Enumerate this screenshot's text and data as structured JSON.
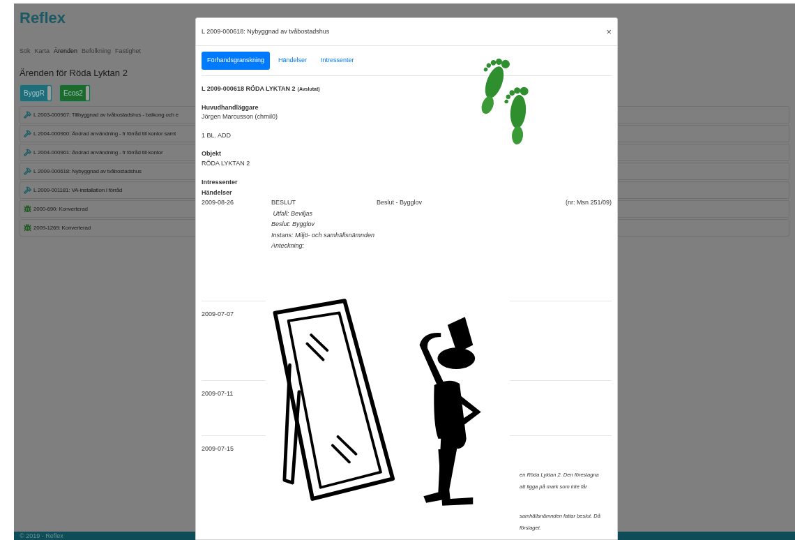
{
  "app": {
    "brand": "Reflex",
    "nav": [
      {
        "label": "Sök",
        "selected": false
      },
      {
        "label": "Karta",
        "selected": false
      },
      {
        "label": "Ärenden",
        "selected": true
      },
      {
        "label": "Befolkning",
        "selected": false
      },
      {
        "label": "Fastighet",
        "selected": false
      }
    ],
    "heading": "Ärenden för Röda Lyktan 2",
    "systems": [
      {
        "label": "ByggR",
        "color": "#1f6d7a",
        "on": true
      },
      {
        "label": "Ecos2",
        "color": "#1d6b2c",
        "on": true
      }
    ],
    "cases": [
      {
        "kind": "hammer",
        "label": "L 2003-000967: Tillbyggnad av tvåbostadshus - balkong och e"
      },
      {
        "kind": "hammer",
        "label": "L 2004-000960: Ändrad användning - fr förråd till kontor samt"
      },
      {
        "kind": "hammer",
        "label": "L 2004-000961: Ändrad användning - fr förråd till kontor"
      },
      {
        "kind": "hammer",
        "label": "L 2009-000618: Nybyggnad av tvåbostadshus"
      },
      {
        "kind": "hammer",
        "label": "L 2009-001181: VA-installation i förråd"
      },
      {
        "kind": "bug",
        "label": "2000-690: Konverterad"
      },
      {
        "kind": "bug",
        "label": "2009-1269: Konverterad"
      }
    ],
    "footer": "© 2019 - Reflex"
  },
  "modal": {
    "title": "L 2009-000618: Nybyggnad av tvåbostadshus",
    "close": "×",
    "tabs": [
      {
        "label": "Förhandsgranskning",
        "selected": true
      },
      {
        "label": "Händelser",
        "selected": false
      },
      {
        "label": "Intressenter",
        "selected": false
      }
    ],
    "case_title": "L 2009-000618 RÖDA LYKTAN 2",
    "case_status": "(Avslutat)",
    "handler_label": "Huvudhandläggare",
    "handler": "Jörgen Marcusson (chrnil0)",
    "note": "1 BL. ADD",
    "object_label": "Objekt",
    "object": "RÖDA LYKTAN 2",
    "stakeholders_label": "Intressenter",
    "events_label": "Händelser",
    "events": [
      {
        "date": "2009-08-26",
        "type": "BESLUT",
        "description": "Beslut - Bygglov",
        "number": "(nr: Msn 251/09)",
        "details": [
          " Utfall: Beviljas",
          "Beslut: Bygglov",
          "Instans: Miljö- och samhällsnämnden",
          "Anteckning:"
        ]
      },
      {
        "date": "2009-07-07"
      },
      {
        "date": "2009-07-11"
      },
      {
        "date": "2009-07-15",
        "notes": [
          "en Röda Lyktan 2. Den föreslagna",
          "att ligga på mark som inte får",
          "samhällsnämnden fattar beslut. Då",
          "förslaget."
        ]
      }
    ]
  }
}
